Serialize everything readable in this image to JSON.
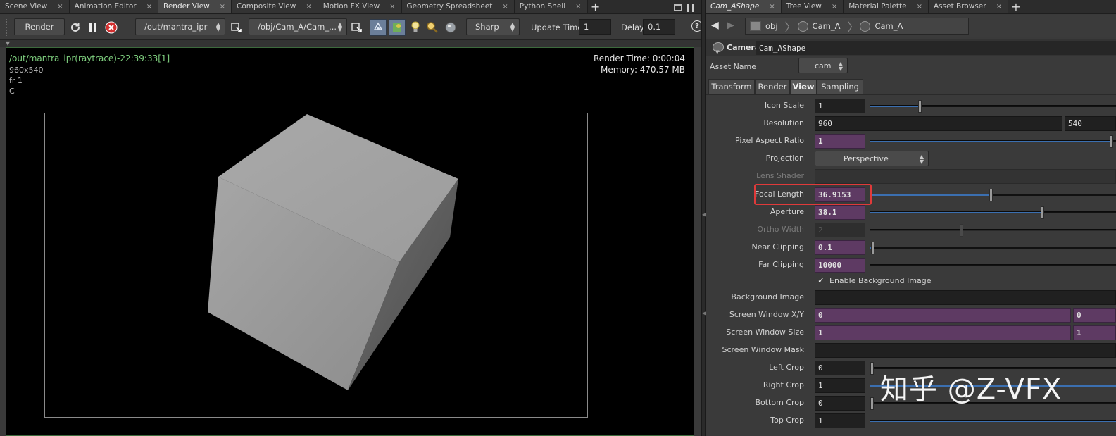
{
  "left_tabs": [
    {
      "label": "Scene View",
      "active": false
    },
    {
      "label": "Animation Editor",
      "active": false
    },
    {
      "label": "Render View",
      "active": true
    },
    {
      "label": "Composite View",
      "active": false
    },
    {
      "label": "Motion FX View",
      "active": false
    },
    {
      "label": "Geometry Spreadsheet",
      "active": false
    },
    {
      "label": "Python Shell",
      "active": false
    }
  ],
  "right_tabs": [
    {
      "label": "Cam_AShape",
      "active": true
    },
    {
      "label": "Tree View",
      "active": false
    },
    {
      "label": "Material Palette",
      "active": false
    },
    {
      "label": "Asset Browser",
      "active": false
    }
  ],
  "tab_close": "×",
  "plus": "+",
  "toolbar": {
    "render_label": "Render",
    "driver_path": "/out/mantra_ipr",
    "camera_path": "/obj/Cam_A/Cam_...",
    "filter": "Sharp",
    "update_time_label": "Update Time",
    "update_time": "1",
    "delay_label": "Delay",
    "delay": "0.1",
    "help": "?"
  },
  "viewport": {
    "title": "/out/mantra_ipr(raytrace)-22:39:33[1]",
    "resolution": "960x540",
    "frame": "fr 1",
    "channel": "C",
    "render_time": "Render Time: 0:00:04",
    "memory_label": "Memory:",
    "memory": "470.57 MB"
  },
  "path": {
    "root": "obj",
    "items": [
      "Cam_A",
      "Cam_A"
    ]
  },
  "node": {
    "type": "Camera",
    "name": "Cam_AShape"
  },
  "asset": {
    "label": "Asset Name",
    "value": "cam"
  },
  "param_tabs": [
    "Transform",
    "Render",
    "View",
    "Sampling"
  ],
  "params": {
    "icon_scale": {
      "label": "Icon Scale",
      "value": "1",
      "slider": 0.2
    },
    "resolution": {
      "label": "Resolution",
      "x": "960",
      "y": "540"
    },
    "pixel_aspect": {
      "label": "Pixel Aspect Ratio",
      "value": "1",
      "slider": 0.98
    },
    "projection": {
      "label": "Projection",
      "value": "Perspective"
    },
    "lens_shader": {
      "label": "Lens Shader"
    },
    "focal_length": {
      "label": "Focal Length",
      "value": "36.9153",
      "slider": 0.49
    },
    "aperture": {
      "label": "Aperture",
      "value": "38.1",
      "slider": 0.7
    },
    "ortho_width": {
      "label": "Ortho Width",
      "value": "2",
      "slider": 0.37
    },
    "near_clipping": {
      "label": "Near Clipping",
      "value": "0.1",
      "slider": 0.01
    },
    "far_clipping": {
      "label": "Far Clipping",
      "value": "10000",
      "slider": 0
    },
    "enable_bg": {
      "label": "Enable Background Image",
      "check": "✓"
    },
    "bg_image": {
      "label": "Background Image"
    },
    "screen_window_xy": {
      "label": "Screen Window X/Y",
      "x": "0",
      "y": "0"
    },
    "screen_window_size": {
      "label": "Screen Window Size",
      "x": "1",
      "y": "1"
    },
    "screen_window_mask": {
      "label": "Screen Window Mask"
    },
    "left_crop": {
      "label": "Left Crop",
      "value": "0",
      "slider": 0
    },
    "right_crop": {
      "label": "Right Crop",
      "value": "1",
      "slider": 1
    },
    "bottom_crop": {
      "label": "Bottom Crop",
      "value": "0",
      "slider": 0
    },
    "top_crop": {
      "label": "Top Crop",
      "value": "1",
      "slider": 1
    }
  },
  "watermark": "知乎 @Z-VFX",
  "colors": {
    "highlight": "#e03a3a",
    "purple_field": "#5e3a63",
    "slider_blue": "#3b6fb0",
    "viewport_text": "#7fd07f"
  }
}
